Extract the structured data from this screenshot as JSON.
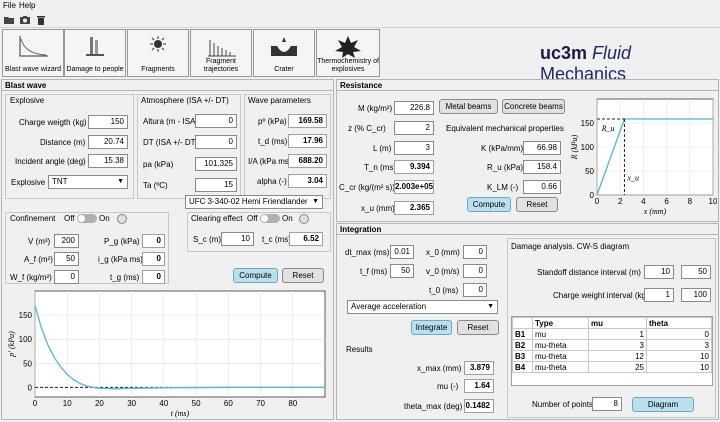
{
  "menu": [
    "File",
    "Help"
  ],
  "tabs": [
    {
      "label": "Blast wave wizard",
      "icon": "blast-wave-icon"
    },
    {
      "label": "Damage to people",
      "icon": "damage-people-icon"
    },
    {
      "label": "Fragments",
      "icon": "fragments-icon"
    },
    {
      "label": "Fragment trajectories",
      "icon": "trajectories-icon"
    },
    {
      "label": "Crater",
      "icon": "crater-icon"
    },
    {
      "label": "Thermochemistry of explosives",
      "icon": "explosion-icon"
    }
  ],
  "logo": {
    "uc": "uc3m",
    "fluid": "Fluid",
    "mech": "Mechanics"
  },
  "blast": {
    "title": "Blast wave",
    "explosive": {
      "title": "Explosive",
      "charge_label": "Charge weigth (kg)",
      "charge": "150",
      "distance_label": "Distance (m)",
      "distance": "20.74",
      "angle_label": "Incident angle (deg)",
      "angle": "15.38",
      "type_label": "Explosive",
      "type": "TNT"
    },
    "atmosphere": {
      "title": "Atmosphere (ISA +/- DT)",
      "alt_label": "Altura (m - ISA)",
      "alt": "0",
      "dt_label": "DT (ISA +/- DT)",
      "dt": "0",
      "pa_label": "pa (kPa)",
      "pa": "101.325",
      "ta_label": "Ta (ºC)",
      "ta": "15"
    },
    "wave": {
      "title": "Wave parameters",
      "p_label": "pº (kPa)",
      "p": "169.58",
      "td_label": "t_d (ms)",
      "td": "17.96",
      "ia_label": "I/A (kPa ms)",
      "ia": "688.20",
      "alpha_label": "alpha (-)",
      "alpha": "3.04"
    },
    "method": "UFC 3-340-02 Hemi Friendlander",
    "confinement": {
      "title": "Confinement",
      "off": "Off",
      "on": "On",
      "v_label": "V (m³)",
      "v": "200",
      "pg_label": "P_g (kPa)",
      "pg": "0",
      "af_label": "A_f (m²)",
      "af": "50",
      "ig_label": "i_g (kPa ms)",
      "ig": "0",
      "wf_label": "W_f (kg/m²)",
      "wf": "0",
      "tg_label": "t_g (ms)",
      "tg": "0"
    },
    "clearing": {
      "title": "Clearing effect",
      "off": "Off",
      "on": "On",
      "sc_label": "S_c (m)",
      "sc": "10",
      "tc_label": "t_c (ms)",
      "tc": "6.52"
    },
    "compute": "Compute",
    "reset": "Reset"
  },
  "chart_data": [
    {
      "type": "line",
      "xlabel": "t (ms)",
      "ylabel": "p' (kPa)",
      "xlim": [
        0,
        90
      ],
      "ylim": [
        -20,
        200
      ],
      "xticks": [
        "0",
        "10",
        "20",
        "30",
        "40",
        "50",
        "60",
        "70",
        "80"
      ],
      "yticks": [
        "0",
        "50",
        "100",
        "150"
      ],
      "series": [
        {
          "x": [
            0,
            2,
            4,
            6,
            8,
            10,
            12,
            14,
            16,
            17.96,
            20,
            25,
            30,
            40,
            60,
            80,
            90
          ],
          "y": [
            169.58,
            123,
            88,
            62,
            42,
            27,
            16,
            8,
            3,
            0,
            -2,
            -3,
            -2,
            -1,
            0,
            0,
            0
          ]
        }
      ],
      "reference": {
        "style": "dashed",
        "y": 0
      }
    },
    {
      "type": "line",
      "xlabel": "x (mm)",
      "ylabel": "R (kPa)",
      "xlim": [
        0,
        10
      ],
      "ylim": [
        0,
        200
      ],
      "xticks": [
        "0",
        "2",
        "4",
        "6",
        "8",
        "10"
      ],
      "yticks": [
        "0",
        "50",
        "100",
        "150"
      ],
      "series": [
        {
          "x": [
            0,
            2.365,
            10
          ],
          "y": [
            0,
            158.4,
            158.4
          ]
        }
      ],
      "annotations": [
        "R_u",
        "x_u"
      ]
    }
  ],
  "resistance": {
    "title": "Resistance",
    "m_label": "M (kg/m²)",
    "m": "226.8",
    "z_label": "z (% C_cr)",
    "z": "2",
    "l_label": "L (m)",
    "l": "3",
    "tn_label": "T_n (ms)",
    "tn": "9.394",
    "ccr_label": "C_cr (kg/(m² s))",
    "ccr": "2.003e+05",
    "xu_label": "x_u (mm)",
    "xu": "2.365",
    "metal": "Metal beams",
    "concrete": "Concrete beams",
    "eq_title": "Equivalent mechanical properties",
    "k_label": "K (kPa/mm)",
    "k": "66.98",
    "ru_label": "R_u (kPa)",
    "ru": "158.4",
    "klm_label": "K_LM (-)",
    "klm": "0.66",
    "compute": "Compute",
    "reset": "Reset"
  },
  "integration": {
    "title": "Integration",
    "dt_label": "dt_max (ms)",
    "dt": "0.01",
    "tf_label": "t_f (ms)",
    "tf": "50",
    "x0_label": "x_0 (mm)",
    "x0": "0",
    "v0_label": "v_0 (m/s)",
    "v0": "0",
    "t0_label": "t_0 (ms)",
    "t0": "0",
    "scheme": "Average acceleration",
    "integrate": "Integrate",
    "reset": "Reset",
    "results_title": "Results",
    "xmax_label": "x_max (mm)",
    "xmax": "3.879",
    "mu_label": "mu (-)",
    "mu": "1.64",
    "theta_label": "theta_max (deg)",
    "theta": "0.1482"
  },
  "damage": {
    "title": "Damage analysis. CW-S diagram",
    "standoff_label": "Standoff distance interval (m)",
    "standoff_min": "10",
    "standoff_max": "50",
    "charge_label": "Charge weight interval (kg)",
    "charge_min": "1",
    "charge_max": "100",
    "headers": [
      "",
      "Type",
      "mu",
      "theta"
    ],
    "rows": [
      [
        "B1",
        "mu",
        "1",
        "0"
      ],
      [
        "B2",
        "mu-theta",
        "3",
        "3"
      ],
      [
        "B3",
        "mu-theta",
        "12",
        "10"
      ],
      [
        "B4",
        "mu-theta",
        "25",
        "10"
      ]
    ],
    "points_label": "Number of points",
    "points": "8",
    "diagram": "Diagram"
  }
}
